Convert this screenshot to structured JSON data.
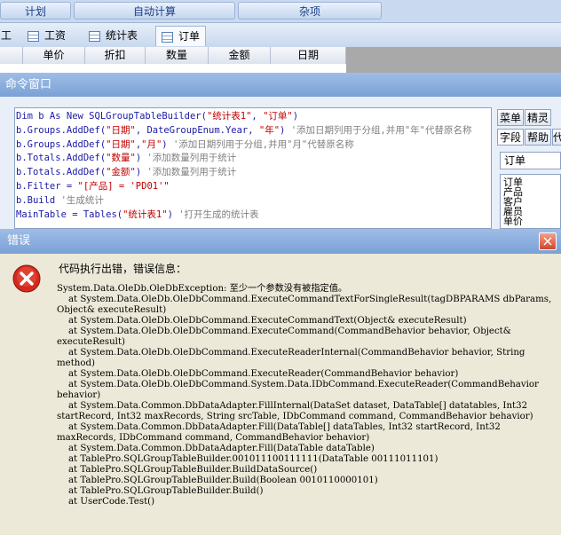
{
  "topnav": {
    "items": [
      "计划",
      "自动计算",
      "杂项"
    ]
  },
  "tabs": [
    {
      "label": "工"
    },
    {
      "label": "工资"
    },
    {
      "label": "统计表"
    },
    {
      "label": "订单"
    }
  ],
  "grid": {
    "columns": [
      "单价",
      "折扣",
      "数量",
      "金额",
      "日期"
    ]
  },
  "command_window": {
    "title": "命令窗口",
    "code_lines": [
      [
        [
          "kw",
          "Dim b As New SQLGroupTableBuilder("
        ],
        [
          "str",
          "\"统计表1\""
        ],
        [
          "kw",
          ", "
        ],
        [
          "str",
          "\"订单\""
        ],
        [
          "kw",
          ")"
        ]
      ],
      [
        [
          "kw",
          "b.Groups.AddDef("
        ],
        [
          "str",
          "\"日期\""
        ],
        [
          "kw",
          ", DateGroupEnum.Year, "
        ],
        [
          "str",
          "\"年\""
        ],
        [
          "kw",
          ") "
        ],
        [
          "cm",
          "'添加日期列用于分组,并用\"年\"代替原名称"
        ]
      ],
      [
        [
          "kw",
          "b.Groups.AddDef("
        ],
        [
          "str",
          "\"日期\""
        ],
        [
          "kw",
          ","
        ],
        [
          "str",
          "\"月\""
        ],
        [
          "kw",
          ") "
        ],
        [
          "cm",
          "'添加日期列用于分组,并用\"月\"代替原名称"
        ]
      ],
      [
        [
          "kw",
          "b.Totals.AddDef("
        ],
        [
          "str",
          "\"数量\""
        ],
        [
          "kw",
          ") "
        ],
        [
          "cm",
          "'添加数量列用于统计"
        ]
      ],
      [
        [
          "kw",
          "b.Totals.AddDef("
        ],
        [
          "str",
          "\"金额\""
        ],
        [
          "kw",
          ") "
        ],
        [
          "cm",
          "'添加数量列用于统计"
        ]
      ],
      [
        [
          "kw",
          "b.Filter = "
        ],
        [
          "str",
          "\"[产品] = 'PD01'\""
        ]
      ],
      [
        [
          "kw",
          "b.Build "
        ],
        [
          "cm",
          "'生成统计"
        ]
      ],
      [
        [
          "txt",
          "MainTable = Tables("
        ],
        [
          "str",
          "\"统计表1\""
        ],
        [
          "txt",
          ") "
        ],
        [
          "cm",
          "'打开生成的统计表"
        ]
      ]
    ],
    "side_tabs_row1": [
      "菜单",
      "精灵"
    ],
    "side_tabs_row2": [
      "字段",
      "帮助",
      "代"
    ],
    "table_input": "订单",
    "field_list": [
      "订单",
      "产品",
      "客户",
      "雇员",
      "单价"
    ]
  },
  "error_dialog": {
    "title": "错误",
    "close_glyph": "×",
    "heading": "代码执行出错，错误信息：",
    "message": "System.Data.OleDb.OleDbException: 至少一个参数没有被指定值。\n    at System.Data.OleDb.OleDbCommand.ExecuteCommandTextForSingleResult(tagDBPARAMS dbParams, Object& executeResult)\n    at System.Data.OleDb.OleDbCommand.ExecuteCommandText(Object& executeResult)\n    at System.Data.OleDb.OleDbCommand.ExecuteCommand(CommandBehavior behavior, Object& executeResult)\n    at System.Data.OleDb.OleDbCommand.ExecuteReaderInternal(CommandBehavior behavior, String method)\n    at System.Data.OleDb.OleDbCommand.ExecuteReader(CommandBehavior behavior)\n    at System.Data.OleDb.OleDbCommand.System.Data.IDbCommand.ExecuteReader(CommandBehavior behavior)\n    at System.Data.Common.DbDataAdapter.FillInternal(DataSet dataset, DataTable[] datatables, Int32 startRecord, Int32 maxRecords, String srcTable, IDbCommand command, CommandBehavior behavior)\n    at System.Data.Common.DbDataAdapter.Fill(DataTable[] dataTables, Int32 startRecord, Int32 maxRecords, IDbCommand command, CommandBehavior behavior)\n    at System.Data.Common.DbDataAdapter.Fill(DataTable dataTable)\n    at TablePro.SQLGroupTableBuilder.001011100111111(DataTable 00111011101)\n    at TablePro.SQLGroupTableBuilder.BuildDataSource()\n    at TablePro.SQLGroupTableBuilder.Build(Boolean 0010110000101)\n    at TablePro.SQLGroupTableBuilder.Build()\n    at UserCode.Test()",
    "icon": "error-icon"
  }
}
